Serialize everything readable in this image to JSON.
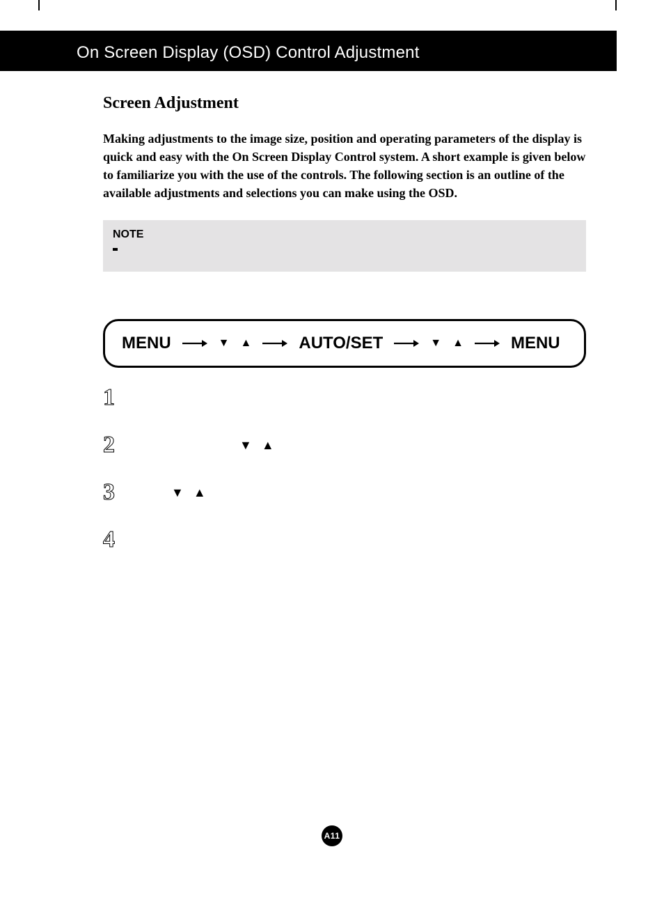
{
  "header": {
    "title": "On Screen Display (OSD) Control Adjustment"
  },
  "section": {
    "heading": "Screen Adjustment",
    "intro": "Making adjustments to the image size, position and operating parameters of the display is quick and easy with the On Screen Display Control system. A short example is given below to familiarize you with the use of the controls. The following section is an outline of the available adjustments and selections you can make using the OSD."
  },
  "note": {
    "label": "NOTE"
  },
  "flow": {
    "step1": "MENU",
    "step2": "AUTO/SET",
    "step3": "MENU"
  },
  "steps": {
    "n1": "1",
    "n2": "2",
    "n3": "3",
    "n4": "4"
  },
  "page": {
    "number": "A11"
  },
  "icons": {
    "down": "▼",
    "up": "▲"
  }
}
